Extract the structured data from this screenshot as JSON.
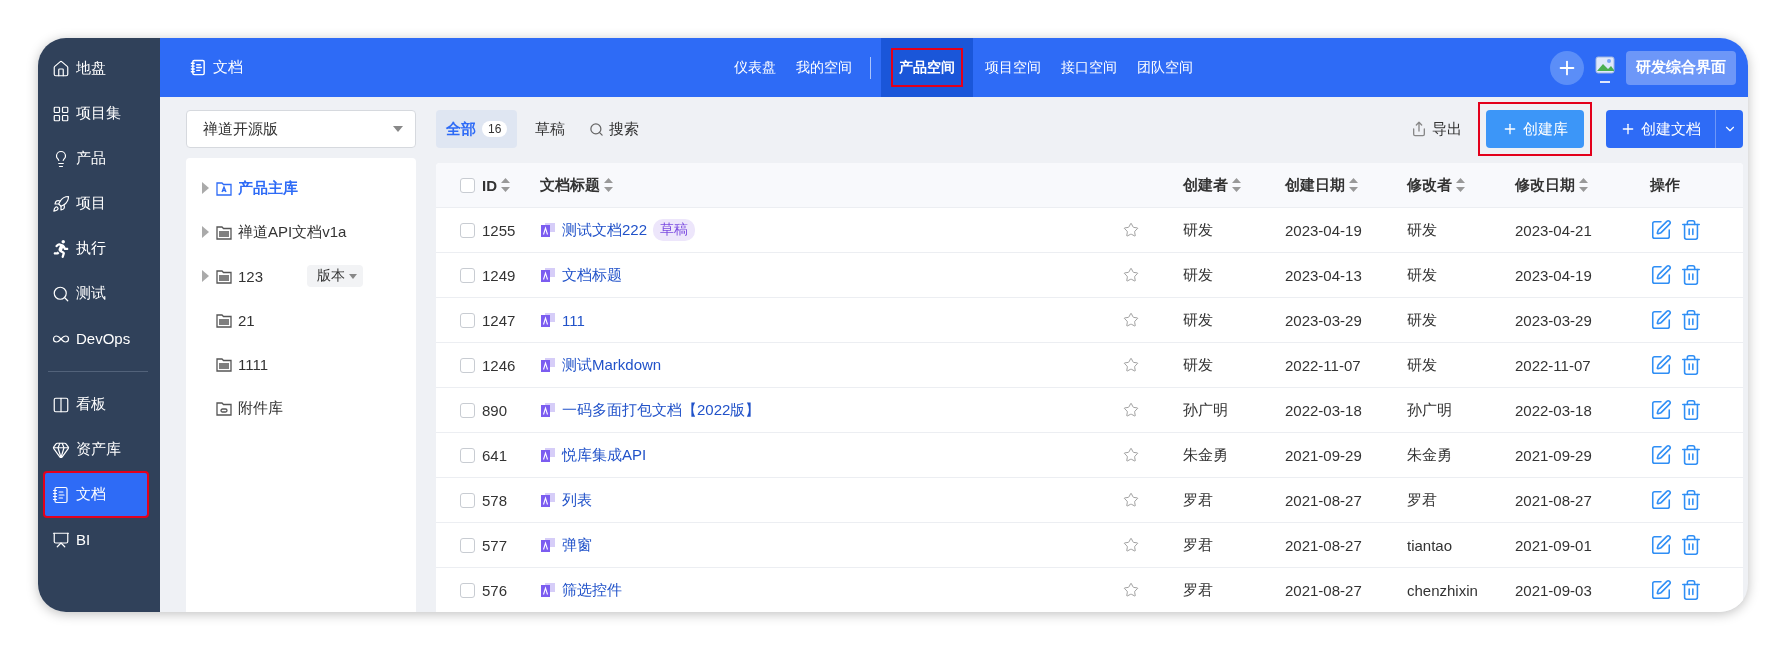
{
  "sidebar": {
    "groups": [
      [
        {
          "label": "地盘",
          "selected": false,
          "highlighted": false
        },
        {
          "label": "项目集",
          "selected": false,
          "highlighted": false
        },
        {
          "label": "产品",
          "selected": false,
          "highlighted": false
        },
        {
          "label": "项目",
          "selected": false,
          "highlighted": false
        },
        {
          "label": "执行",
          "selected": false,
          "highlighted": false
        },
        {
          "label": "测试",
          "selected": false,
          "highlighted": false
        },
        {
          "label": "DevOps",
          "selected": false,
          "highlighted": false
        }
      ],
      [
        {
          "label": "看板",
          "selected": false,
          "highlighted": false
        },
        {
          "label": "资产库",
          "selected": false,
          "highlighted": false
        },
        {
          "label": "文档",
          "selected": true,
          "highlighted": true
        },
        {
          "label": "BI",
          "selected": false,
          "highlighted": false
        }
      ]
    ]
  },
  "topbar": {
    "title": "文档",
    "nav_groups": [
      [
        {
          "label": "仪表盘",
          "selected": false,
          "highlighted": false
        },
        {
          "label": "我的空间",
          "selected": false,
          "highlighted": false
        }
      ],
      [
        {
          "label": "产品空间",
          "selected": true,
          "highlighted": true
        },
        {
          "label": "项目空间",
          "selected": false,
          "highlighted": false
        },
        {
          "label": "接口空间",
          "selected": false,
          "highlighted": false
        },
        {
          "label": "团队空间",
          "selected": false,
          "highlighted": false
        }
      ]
    ],
    "account_button": "研发综合界面"
  },
  "library_select": {
    "value": "禅道开源版"
  },
  "tree": [
    {
      "label": "产品主库",
      "kind": "library",
      "expandable": true,
      "selected": true
    },
    {
      "label": "禅道API文档v1a",
      "kind": "folder",
      "expandable": true,
      "selected": false
    },
    {
      "label": "123",
      "kind": "folder",
      "expandable": true,
      "selected": false,
      "version": "版本"
    },
    {
      "label": "21",
      "kind": "folder",
      "expandable": false,
      "selected": false
    },
    {
      "label": "1111",
      "kind": "folder",
      "expandable": false,
      "selected": false
    },
    {
      "label": "附件库",
      "kind": "attachment",
      "expandable": false,
      "selected": false
    }
  ],
  "toolbar": {
    "tabs": [
      {
        "label": "全部",
        "count": "16",
        "selected": true
      },
      {
        "label": "草稿",
        "selected": false
      }
    ],
    "search": "搜索",
    "export": "导出",
    "create_library": {
      "label": "创建库",
      "highlighted": true
    },
    "create_doc": {
      "label": "创建文档",
      "highlighted": false
    }
  },
  "table": {
    "select_all": {
      "checked": false
    },
    "columns": [
      {
        "label": "ID",
        "sortable": true
      },
      {
        "label": "文档标题",
        "sortable": true
      },
      {
        "label": "创建者",
        "sortable": true
      },
      {
        "label": "创建日期",
        "sortable": true
      },
      {
        "label": "修改者",
        "sortable": true
      },
      {
        "label": "修改日期",
        "sortable": true
      },
      {
        "label": "操作",
        "sortable": false
      }
    ],
    "rows": [
      {
        "id": "1255",
        "title": "测试文档222",
        "badge": "草稿",
        "checked": false,
        "starred": false,
        "creator": "研发",
        "created": "2023-04-19",
        "modifier": "研发",
        "modified": "2023-04-21"
      },
      {
        "id": "1249",
        "title": "文档标题",
        "checked": false,
        "starred": false,
        "creator": "研发",
        "created": "2023-04-13",
        "modifier": "研发",
        "modified": "2023-04-19"
      },
      {
        "id": "1247",
        "title": "111",
        "checked": false,
        "starred": false,
        "creator": "研发",
        "created": "2023-03-29",
        "modifier": "研发",
        "modified": "2023-03-29"
      },
      {
        "id": "1246",
        "title": "测试Markdown",
        "checked": false,
        "starred": false,
        "creator": "研发",
        "created": "2022-11-07",
        "modifier": "研发",
        "modified": "2022-11-07"
      },
      {
        "id": "890",
        "title": "一码多面打包文档【2022版】",
        "checked": false,
        "starred": false,
        "creator": "孙广明",
        "created": "2022-03-18",
        "modifier": "孙广明",
        "modified": "2022-03-18"
      },
      {
        "id": "641",
        "title": "悦库集成API",
        "checked": false,
        "starred": false,
        "creator": "朱金勇",
        "created": "2021-09-29",
        "modifier": "朱金勇",
        "modified": "2021-09-29"
      },
      {
        "id": "578",
        "title": "列表",
        "checked": false,
        "starred": false,
        "creator": "罗君",
        "created": "2021-08-27",
        "modifier": "罗君",
        "modified": "2021-08-27"
      },
      {
        "id": "577",
        "title": "弹窗",
        "checked": false,
        "starred": false,
        "creator": "罗君",
        "created": "2021-08-27",
        "modifier": "tiantao",
        "modified": "2021-09-01"
      },
      {
        "id": "576",
        "title": "筛选控件",
        "checked": false,
        "starred": false,
        "creator": "罗君",
        "created": "2021-08-27",
        "modifier": "chenzhixin",
        "modified": "2021-09-03"
      }
    ]
  }
}
